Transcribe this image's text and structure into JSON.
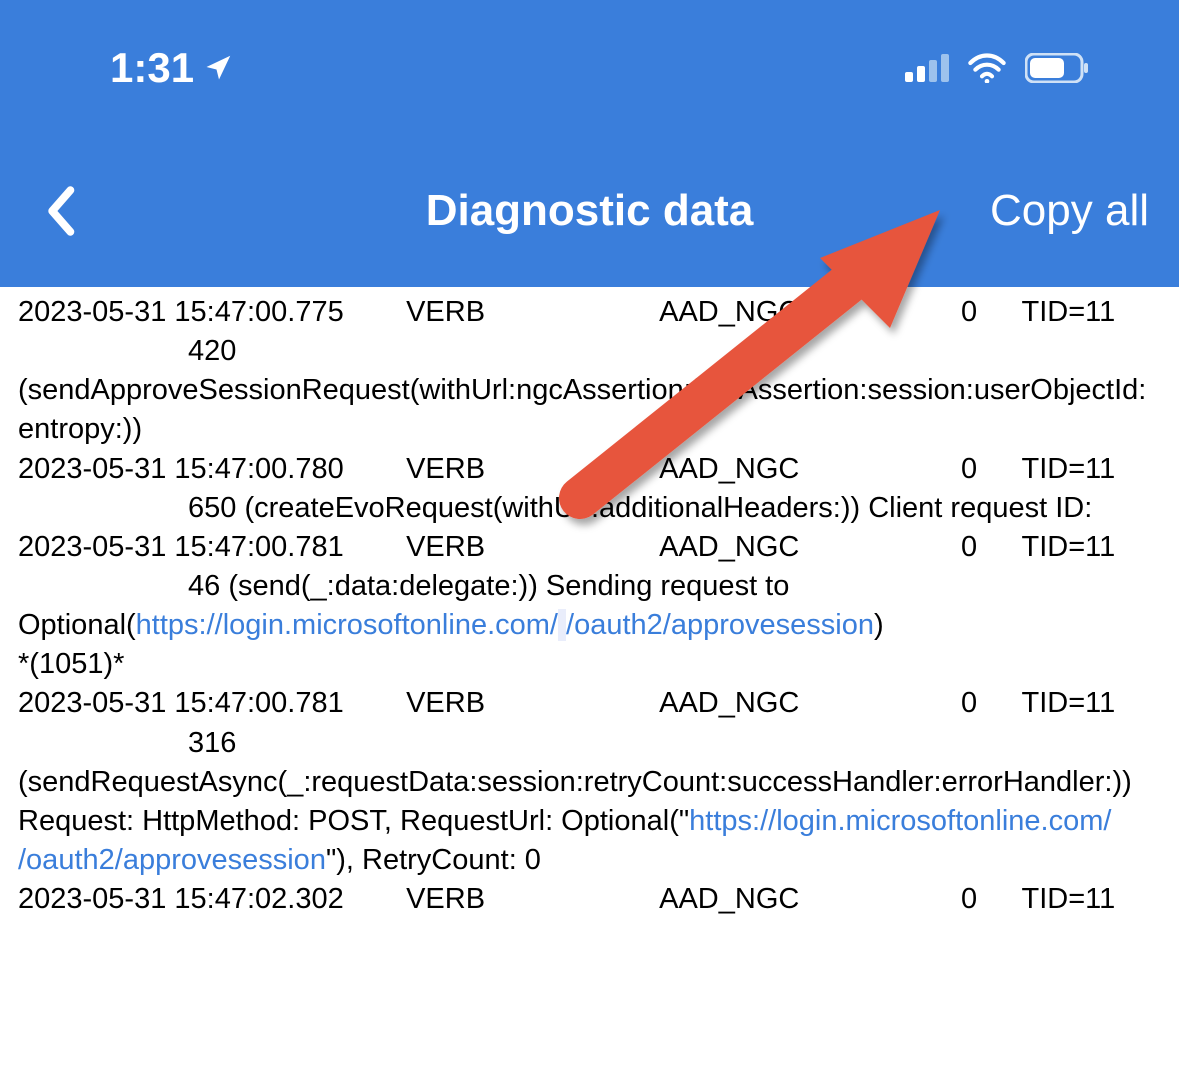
{
  "status": {
    "time": "1:31",
    "location_icon": "location-arrow-icon",
    "signal_icon": "cellular-signal-icon",
    "wifi_icon": "wifi-icon",
    "battery_icon": "battery-icon"
  },
  "nav": {
    "back_icon": "chevron-left-icon",
    "title": "Diagnostic data",
    "copy_all": "Copy all"
  },
  "logs": [
    {
      "time": "2023-05-31 15:47:00.775",
      "level": "VERB",
      "tag": "AAD_NGC",
      "zero": "0",
      "tid": "TID=11",
      "line_no": "420",
      "body": "(sendApproveSessionRequest(withUrl:ngcAssertion:fidoAssertion:session:userObjectId:entropy:))"
    },
    {
      "time": "2023-05-31 15:47:00.780",
      "level": "VERB",
      "tag": "AAD_NGC",
      "zero": "0",
      "tid": "TID=11",
      "line_no": "650",
      "body_prefix": " (createEvoRequest(withUrl:additionalHeaders:)) Client request ID:",
      "redacted_after": "                                            "
    },
    {
      "time": "2023-05-31 15:47:00.781",
      "level": "VERB",
      "tag": "AAD_NGC",
      "zero": "0",
      "tid": "TID=11",
      "line_no": "46",
      "body_prefix": " (send(_:data:delegate:)) Sending request to Optional(",
      "link1": "https://login.microsoftonline.com/",
      "redacted_link": "                                            ",
      "link2": "/oauth2/approvesession",
      "body_suffix": ")",
      "tail": "*(1051)*"
    },
    {
      "time": "2023-05-31 15:47:00.781",
      "level": "VERB",
      "tag": "AAD_NGC",
      "zero": "0",
      "tid": "TID=11",
      "line_no": "316",
      "body_prefix": "(sendRequestAsync(_:requestData:session:retryCount:successHandler:errorHandler:)) Request: HttpMethod: POST, RequestUrl: Optional(\"",
      "link1": "https://login.microsoftonline.com/",
      "redacted_link": "                                            ",
      "link2": "/oauth2/approvesession",
      "body_suffix": "\"), RetryCount: 0"
    },
    {
      "time": "2023-05-31 15:47:02.302",
      "level": "VERB",
      "tag": "AAD_NGC",
      "zero": "0",
      "tid": "TID=11"
    }
  ],
  "annotation": {
    "arrow": "red-arrow-pointing-to-copy-all"
  }
}
